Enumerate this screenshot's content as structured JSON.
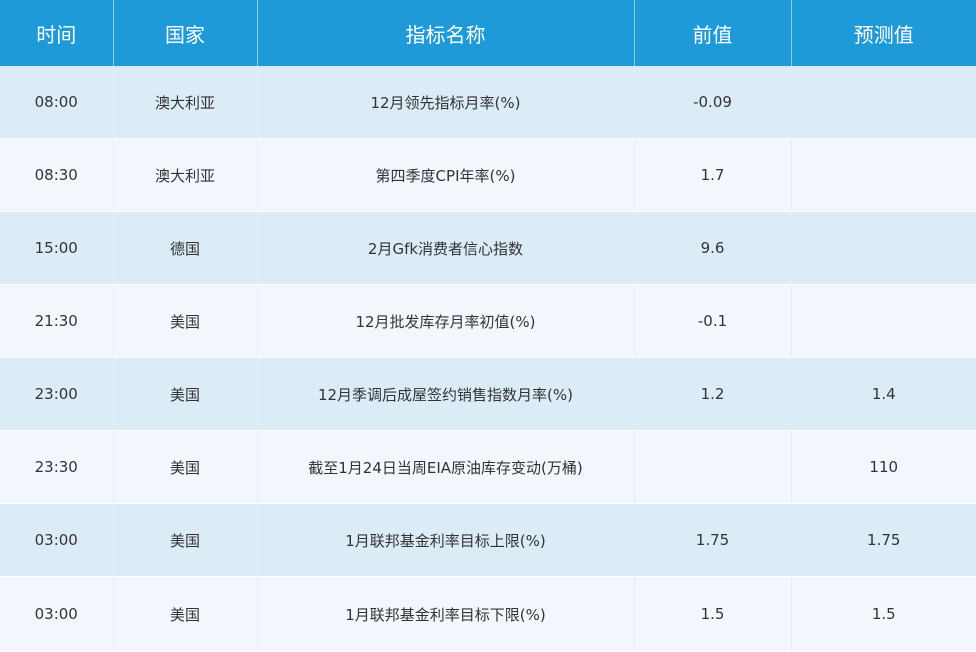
{
  "table": {
    "headers": [
      "时间",
      "国家",
      "指标名称",
      "前值",
      "预测值"
    ],
    "rows": [
      {
        "time": "08:00",
        "country": "澳大利亚",
        "indicator": "12月领先指标月率(%)",
        "previous": "-0.09",
        "forecast": ""
      },
      {
        "time": "08:30",
        "country": "澳大利亚",
        "indicator": "第四季度CPI年率(%)",
        "previous": "1.7",
        "forecast": ""
      },
      {
        "time": "15:00",
        "country": "德国",
        "indicator": "2月Gfk消费者信心指数",
        "previous": "9.6",
        "forecast": ""
      },
      {
        "time": "21:30",
        "country": "美国",
        "indicator": "12月批发库存月率初值(%)",
        "previous": "-0.1",
        "forecast": ""
      },
      {
        "time": "23:00",
        "country": "美国",
        "indicator": "12月季调后成屋签约销售指数月率(%)",
        "previous": "1.2",
        "forecast": "1.4"
      },
      {
        "time": "23:30",
        "country": "美国",
        "indicator": "截至1月24日当周EIA原油库存变动(万桶)",
        "previous": "",
        "forecast": "110"
      },
      {
        "time": "03:00",
        "country": "美国",
        "indicator": "1月联邦基金利率目标上限(%)",
        "previous": "1.75",
        "forecast": "1.75"
      },
      {
        "time": "03:00",
        "country": "美国",
        "indicator": "1月联邦基金利率目标下限(%)",
        "previous": "1.5",
        "forecast": "1.5"
      }
    ]
  },
  "colors": {
    "header_bg": "#1e9ad8",
    "row_odd_bg": "#dcecf7",
    "row_even_bg": "#f1f7fc",
    "text": "#333333"
  }
}
